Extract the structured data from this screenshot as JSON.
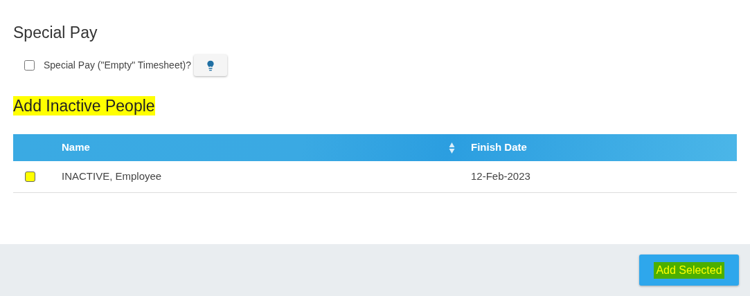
{
  "special_pay": {
    "title": "Special Pay",
    "option": {
      "label": "Special Pay (\"Empty\" Timesheet)?",
      "checked": false
    }
  },
  "inactive_people": {
    "title": "Add Inactive People",
    "title_highlighted": true,
    "table": {
      "columns": [
        {
          "label": "Name",
          "sortable": true
        },
        {
          "label": "Finish Date",
          "sortable": false
        }
      ],
      "rows": [
        {
          "checked": false,
          "highlighted": true,
          "name": "INACTIVE, Employee",
          "finish_date": "12-Feb-2023"
        }
      ]
    }
  },
  "footer": {
    "button": {
      "label": "Add Selected",
      "highlighted": true
    }
  }
}
